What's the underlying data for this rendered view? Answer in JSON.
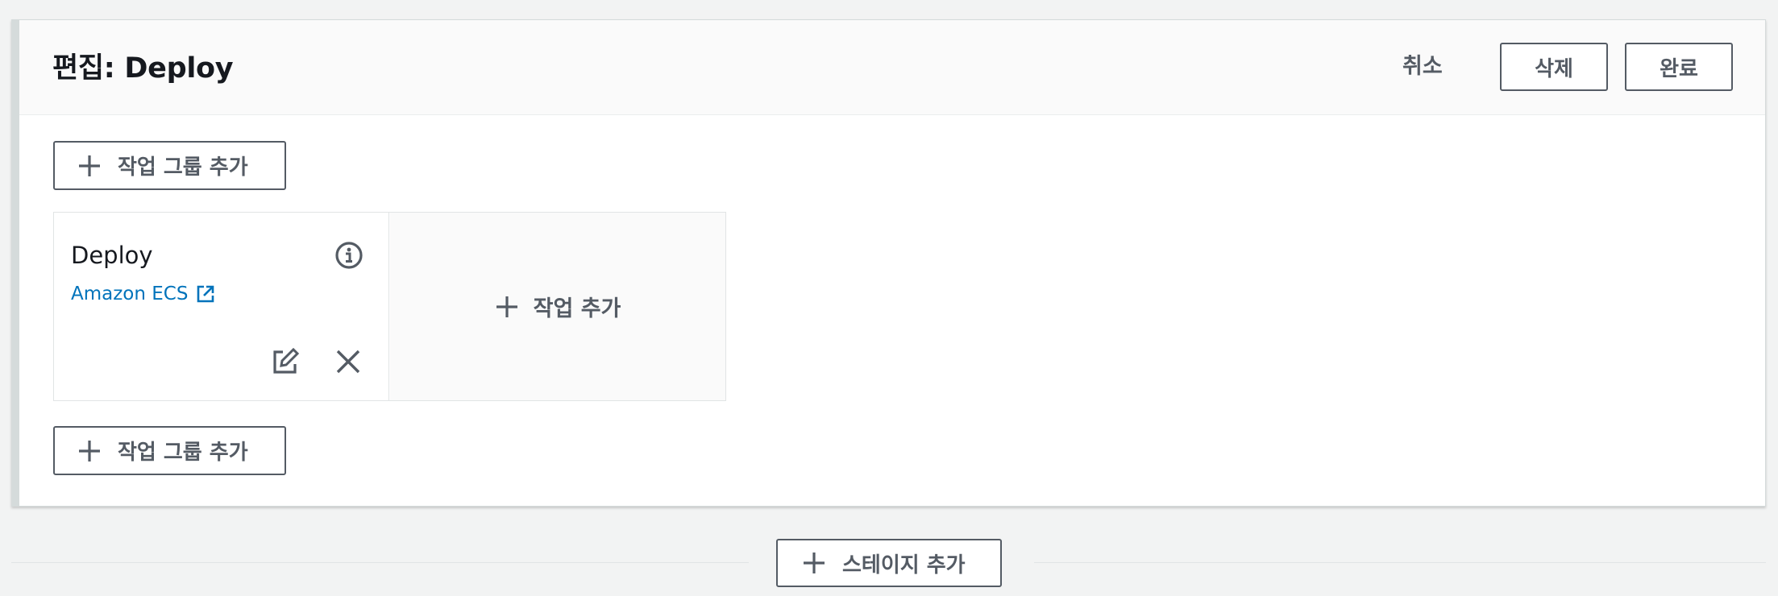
{
  "stage": {
    "title": "편집: Deploy",
    "cancel_label": "취소",
    "delete_label": "삭제",
    "done_label": "완료",
    "add_action_group_top": "작업 그룹 추가",
    "add_action_group_bottom": "작업 그룹 추가"
  },
  "action": {
    "name": "Deploy",
    "provider": "Amazon ECS",
    "add_action_label": "작업 추가",
    "icons": {
      "info": "info-icon",
      "external": "external-link-icon",
      "edit": "edit-icon",
      "remove": "close-icon"
    }
  },
  "footer": {
    "add_stage_label": "스테이지 추가"
  },
  "colors": {
    "accent_link": "#0073bb",
    "button_border": "#545b64",
    "card_border": "#d5dbdb",
    "background": "#f2f3f3"
  }
}
